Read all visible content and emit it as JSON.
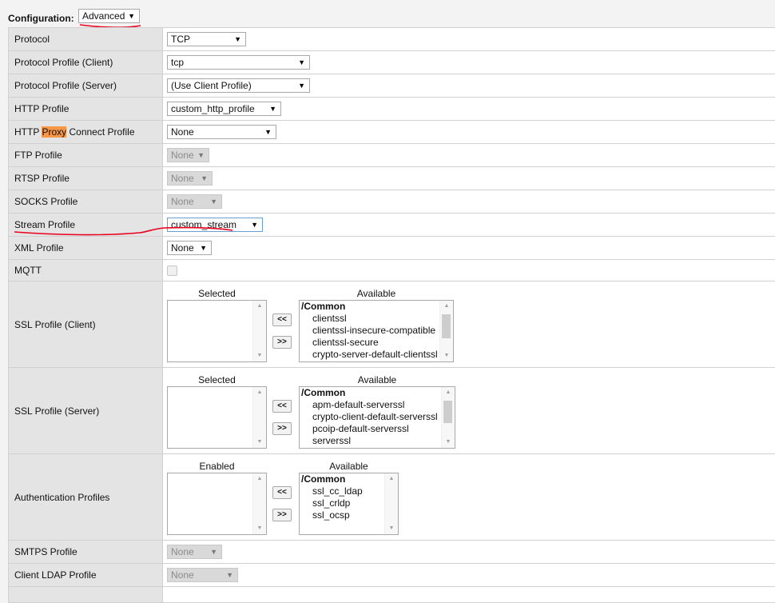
{
  "configuration": {
    "label": "Configuration:",
    "value": "Advanced"
  },
  "rows": [
    {
      "label": "Protocol",
      "value": "TCP"
    },
    {
      "label": "Protocol Profile (Client)",
      "value": "tcp"
    },
    {
      "label": "Protocol Profile (Server)",
      "value": "(Use Client Profile)"
    },
    {
      "label": "HTTP Profile",
      "value": "custom_http_profile"
    },
    {
      "label_pre": "HTTP ",
      "label_hl": "Proxy",
      "label_post": " Connect Profile",
      "value": "None"
    },
    {
      "label": "FTP Profile",
      "value": "None"
    },
    {
      "label": "RTSP Profile",
      "value": "None"
    },
    {
      "label": "SOCKS Profile",
      "value": "None"
    },
    {
      "label": "Stream Profile",
      "value": "custom_stream"
    },
    {
      "label": "XML Profile",
      "value": "None"
    },
    {
      "label": "MQTT"
    },
    {
      "label": "SSL Profile (Client)"
    },
    {
      "label": "SSL Profile (Server)"
    },
    {
      "label": "Authentication Profiles"
    },
    {
      "label": "SMTPS Profile",
      "value": "None"
    },
    {
      "label": "Client LDAP Profile",
      "value": "None"
    }
  ],
  "ssl_client": {
    "selected_header": "Selected",
    "available_header": "Available",
    "group": "/Common",
    "available": [
      "clientssl",
      "clientssl-insecure-compatible",
      "clientssl-secure",
      "crypto-server-default-clientssl"
    ],
    "move_left": "<<",
    "move_right": ">>"
  },
  "ssl_server": {
    "selected_header": "Selected",
    "available_header": "Available",
    "group": "/Common",
    "available": [
      "apm-default-serverssl",
      "crypto-client-default-serverssl",
      "pcoip-default-serverssl",
      "serverssl"
    ],
    "move_left": "<<",
    "move_right": ">>"
  },
  "auth_profiles": {
    "selected_header": "Enabled",
    "available_header": "Available",
    "group": "/Common",
    "available": [
      "ssl_cc_ldap",
      "ssl_crldp",
      "ssl_ocsp"
    ],
    "move_left": "<<",
    "move_right": ">>"
  },
  "annotation_color": "#e8001c"
}
